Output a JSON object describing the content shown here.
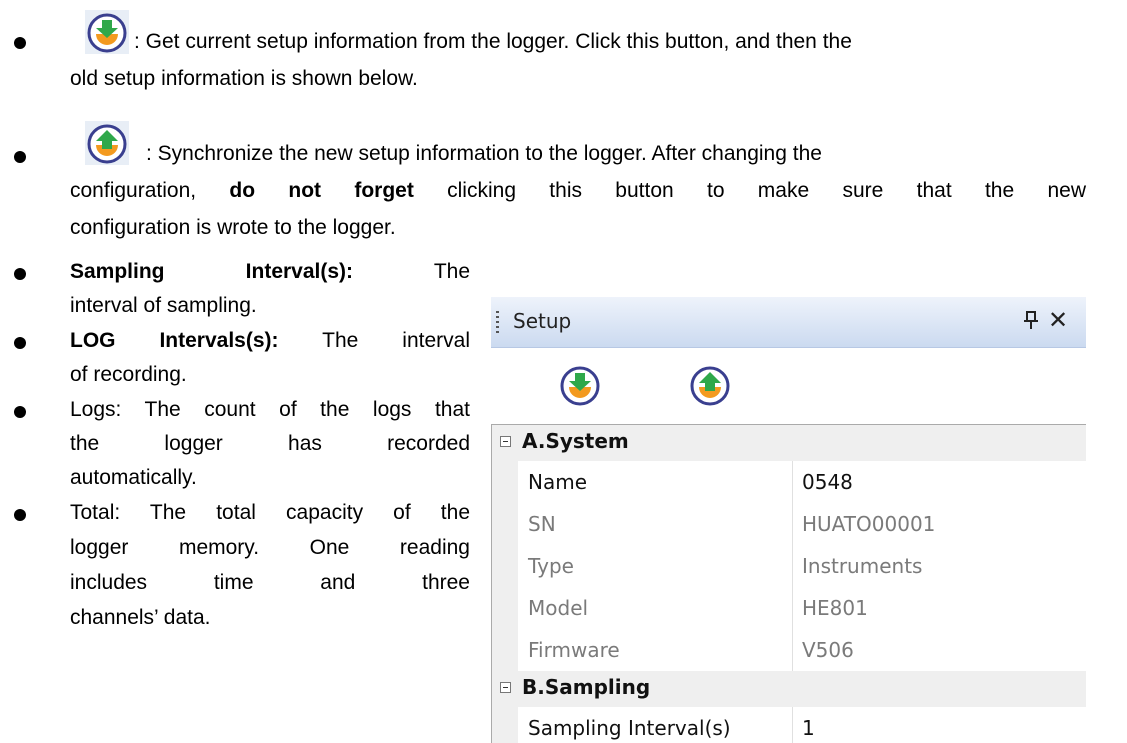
{
  "bullets": {
    "get_setup": {
      "line1": ": Get current setup information from the logger. Click this button, and then the",
      "line2": "old setup information is shown below."
    },
    "sync": {
      "line1": ": Synchronize the new setup information to the logger. After changing the",
      "line2_pre": "configuration,",
      "line2_bold": "do not forget",
      "line2_post": "clicking this button to make sure that the new",
      "line3": "configuration is wrote to the logger."
    },
    "sampling": {
      "term": "Sampling Interval(s):",
      "after": "The",
      "line2": "interval of sampling."
    },
    "log": {
      "term": "LOG Intervals(s):",
      "after": "The interval",
      "line2": "of recording."
    },
    "logs": {
      "line1": "Logs: The count of the logs that",
      "line2": "the logger has recorded",
      "line3": "automatically."
    },
    "total": {
      "line1": "Total: The total capacity of the",
      "line2": "logger memory. One reading",
      "line3": "includes time and three",
      "line4": "channels’ data."
    }
  },
  "panel": {
    "title": "Setup",
    "categories": [
      {
        "label": "A.System",
        "rows": [
          {
            "name": "Name",
            "value": "0548"
          },
          {
            "name": "SN",
            "value": "HUATO00001"
          },
          {
            "name": "Type",
            "value": "Instruments"
          },
          {
            "name": "Model",
            "value": "HE801"
          },
          {
            "name": "Firmware",
            "value": "V506"
          }
        ]
      },
      {
        "label": "B.Sampling",
        "rows": [
          {
            "name": "Sampling Interval(s)",
            "value": "1"
          }
        ]
      }
    ]
  },
  "colors": {
    "icon_green": "#2fa84a",
    "icon_orange": "#f39a1f",
    "icon_ring": "#3a3f8f",
    "header_gradient_top": "#eef3fb",
    "header_gradient_bottom": "#cbdaf0"
  },
  "icons": {
    "get_setup": "download-icon",
    "sync": "upload-icon",
    "pin": "pin-icon",
    "close": "close-icon"
  }
}
